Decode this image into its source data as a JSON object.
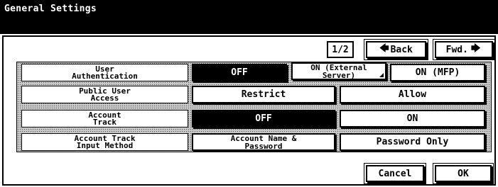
{
  "window": {
    "title": "General Settings"
  },
  "pager": {
    "page": "1/2",
    "back_label": "Back",
    "fwd_label": "Fwd.",
    "back_arrow": "🡄",
    "fwd_arrow": "🡆"
  },
  "settings": {
    "user_authentication": {
      "label": "User\nAuthentication",
      "options": [
        "OFF",
        "ON (External\nServer)",
        "ON (MFP)"
      ],
      "selected": "OFF"
    },
    "public_user_access": {
      "label": "Public User\nAccess",
      "options": [
        "Restrict",
        "Allow"
      ],
      "selected": null
    },
    "account_track": {
      "label": "Account\nTrack",
      "options": [
        "OFF",
        "ON"
      ],
      "selected": "OFF"
    },
    "account_track_input_method": {
      "label": "Account Track\nInput Method",
      "options": [
        "Account Name &\nPassword",
        "Password Only"
      ],
      "selected": null
    }
  },
  "footer": {
    "cancel_label": "Cancel",
    "ok_label": "OK"
  }
}
